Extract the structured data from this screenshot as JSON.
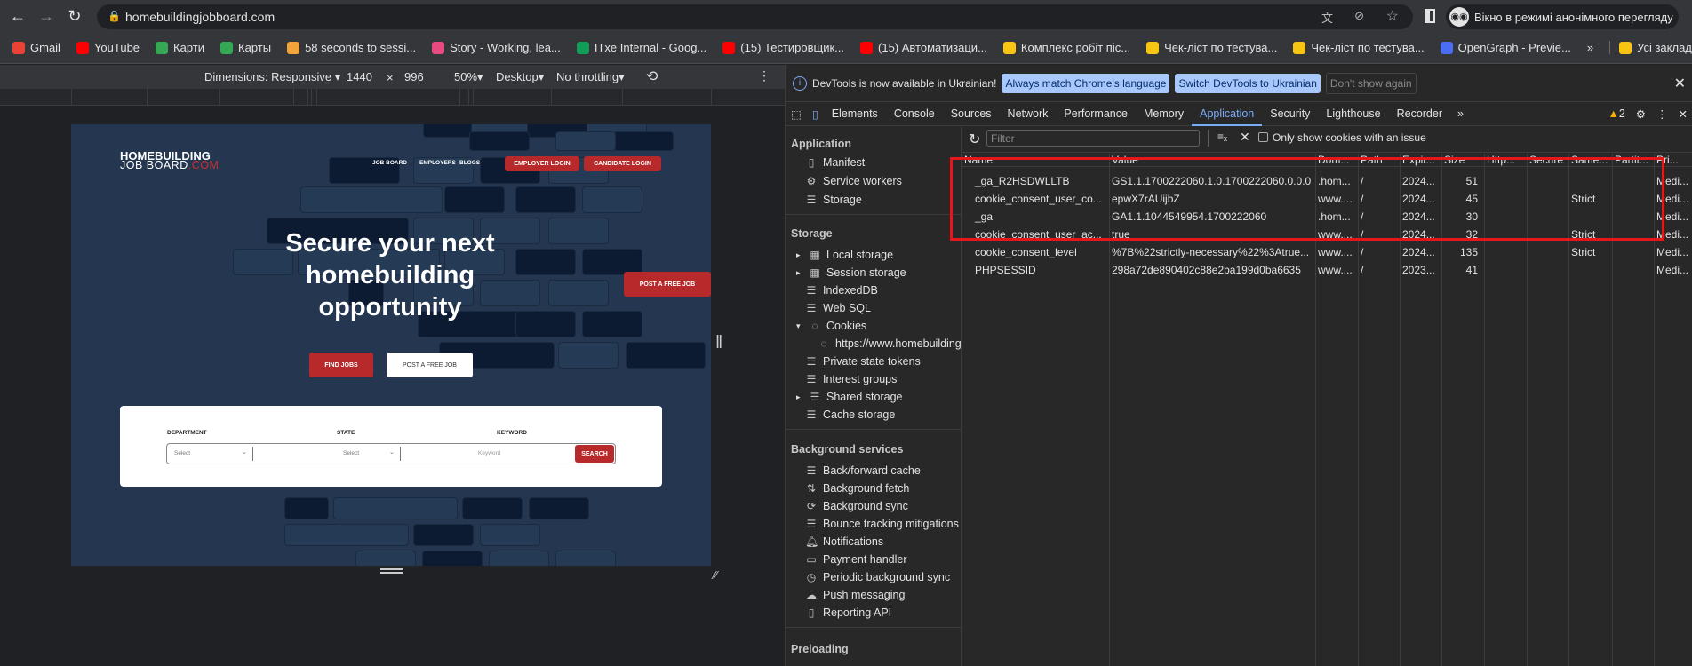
{
  "browser": {
    "url": "homebuildingjobboard.com",
    "incognito_label": "Вікно в режимі анонімного перегляду",
    "bookmarks": [
      {
        "label": "Gmail",
        "color": "#ea4335"
      },
      {
        "label": "YouTube",
        "color": "#ff0000"
      },
      {
        "label": "Карти",
        "color": "#34a853"
      },
      {
        "label": "Карты",
        "color": "#34a853"
      },
      {
        "label": "58 seconds to sessi...",
        "color": "#f4a33a"
      },
      {
        "label": "Story - Working, lea...",
        "color": "#e84a7f"
      },
      {
        "label": "ITxe Internal - Goog...",
        "color": "#0f9d58"
      },
      {
        "label": "(15) Тестировщик...",
        "color": "#ff0000"
      },
      {
        "label": "(15) Автоматизаци...",
        "color": "#ff0000"
      },
      {
        "label": "Комплекс робіт піс...",
        "color": "#f9c513"
      },
      {
        "label": "Чек-ліст по тестува...",
        "color": "#f9c513"
      },
      {
        "label": "Чек-ліст по тестува...",
        "color": "#f9c513"
      },
      {
        "label": "OpenGraph - Previe...",
        "color": "#4b6cf5"
      }
    ],
    "more": "»",
    "all_bookmarks": "Усі закладки"
  },
  "device_toolbar": {
    "dimensions": "Dimensions: Responsive",
    "width": "1440",
    "x": "×",
    "height": "996",
    "zoom": "50%",
    "device": "Desktop",
    "throttling": "No throttling"
  },
  "site": {
    "logo_line1": "HOMEBUILDING",
    "logo_line2": "JOB BOARD",
    "logo_suffix": ".COM",
    "nav": [
      "JOB BOARD",
      "EMPLOYERS",
      "BLOGS"
    ],
    "employer_login": "EMPLOYER LOGIN",
    "candidate_login": "CANDIDATE LOGIN",
    "headline": [
      "Secure your next",
      "homebuilding",
      "opportunity"
    ],
    "post_job_side": "POST A FREE JOB",
    "find_jobs": "FIND JOBS",
    "post_job": "POST A FREE JOB",
    "search": {
      "department_label": "DEPARTMENT",
      "state_label": "STATE",
      "keyword_label": "KEYWORD",
      "department_value": "Select",
      "state_value": "Select",
      "keyword_placeholder": "Keyword",
      "button": "SEARCH"
    }
  },
  "devtools": {
    "info": "DevTools is now available in Ukrainian!",
    "always_match": "Always match Chrome's language",
    "switch": "Switch DevTools to Ukrainian",
    "dont_show": "Don't show again",
    "tabs": [
      "Elements",
      "Console",
      "Sources",
      "Network",
      "Performance",
      "Memory",
      "Application",
      "Security",
      "Lighthouse",
      "Recorder"
    ],
    "active_tab": "Application",
    "warnings": "2",
    "sidebar": {
      "application": {
        "title": "Application",
        "items": [
          "Manifest",
          "Service workers",
          "Storage"
        ]
      },
      "storage": {
        "title": "Storage",
        "items": [
          "Local storage",
          "Session storage",
          "IndexedDB",
          "Web SQL",
          "Cookies",
          "https://www.homebuilding",
          "Private state tokens",
          "Interest groups",
          "Shared storage",
          "Cache storage"
        ]
      },
      "background": {
        "title": "Background services",
        "items": [
          "Back/forward cache",
          "Background fetch",
          "Background sync",
          "Bounce tracking mitigations",
          "Notifications",
          "Payment handler",
          "Periodic background sync",
          "Push messaging",
          "Reporting API"
        ]
      },
      "preloading": {
        "title": "Preloading"
      }
    },
    "filter_placeholder": "Filter",
    "only_issues": "Only show cookies with an issue",
    "columns": [
      "Name",
      "Value",
      "Dom...",
      "Path",
      "Expir...",
      "Size",
      "Http...",
      "Secure",
      "Same...",
      "Partit...",
      "Pri..."
    ],
    "rows": [
      [
        "_ga_R2HSDWLLTB",
        "GS1.1.1700222060.1.0.1700222060.0.0.0",
        ".hom...",
        "/",
        "2024...",
        "51",
        "",
        "",
        "",
        "",
        "Medi..."
      ],
      [
        "cookie_consent_user_co...",
        "epwX7rAUijbZ",
        "www....",
        "/",
        "2024...",
        "45",
        "",
        "",
        "Strict",
        "",
        "Medi..."
      ],
      [
        "_ga",
        "GA1.1.1044549954.1700222060",
        ".hom...",
        "/",
        "2024...",
        "30",
        "",
        "",
        "",
        "",
        "Medi..."
      ],
      [
        "cookie_consent_user_ac...",
        "true",
        "www....",
        "/",
        "2024...",
        "32",
        "",
        "",
        "Strict",
        "",
        "Medi..."
      ],
      [
        "cookie_consent_level",
        "%7B%22strictly-necessary%22%3Atrue...",
        "www....",
        "/",
        "2024...",
        "135",
        "",
        "",
        "Strict",
        "",
        "Medi..."
      ],
      [
        "PHPSESSID",
        "298a72de890402c88e2ba199d0ba6635",
        "www....",
        "/",
        "2023...",
        "41",
        "",
        "",
        "",
        "",
        "Medi..."
      ]
    ],
    "highlight_color": "#e8151b"
  }
}
